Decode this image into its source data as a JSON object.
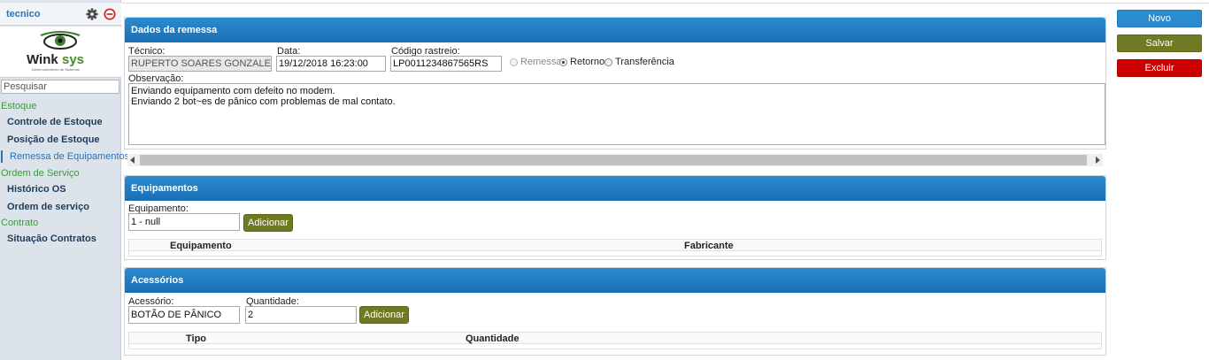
{
  "sidebar": {
    "user": "tecnico",
    "logo_text": "Winksys",
    "logo_tagline": "Desenvolvimento de Sistemas",
    "search_placeholder": "Pesquisar",
    "categories": [
      {
        "label": "Estoque"
      },
      {
        "label": "Ordem de Serviço"
      },
      {
        "label": "Contrato"
      }
    ],
    "items": [
      {
        "label": "Controle de Estoque"
      },
      {
        "label": "Posição de Estoque"
      },
      {
        "label": "Remessa de Equipamentos",
        "active": true
      },
      {
        "label": "Histórico OS"
      },
      {
        "label": "Ordem de serviço"
      },
      {
        "label": "Situação Contratos"
      }
    ],
    "icons": {
      "settings": "gear-icon",
      "logout": "minus-circle-icon"
    }
  },
  "remessa": {
    "title": "Dados da remessa",
    "tecnico_label": "Técnico:",
    "tecnico_value": "RUPERTO SOARES GONZALES",
    "data_label": "Data:",
    "data_value": "19/12/2018 16:23:00",
    "codigo_label": "Código rastreio:",
    "codigo_value": "LP0011234867565RS",
    "radio_remessa": "Remessa",
    "radio_retorno": "Retorno",
    "radio_transferencia": "Transferência",
    "selected_radio": "Retorno",
    "obs_label": "Observação:",
    "obs_line1": "Enviando equipamento com defeito no modem.",
    "obs_line2": "Enviando 2 bot~es de pânico com problemas de mal contato."
  },
  "equipamentos": {
    "title": "Equipamentos",
    "field_label": "Equipamento:",
    "field_value": "1 - null",
    "add_label": "Adicionar",
    "col_equipamento": "Equipamento",
    "col_fabricante": "Fabricante"
  },
  "acessorios": {
    "title": "Acessórios",
    "acessorio_label": "Acessório:",
    "acessorio_value": "BOTÃO DE PÂNICO",
    "quantidade_label": "Quantidade:",
    "quantidade_value": "2",
    "add_label": "Adicionar",
    "col_tipo": "Tipo",
    "col_quantidade": "Quantidade"
  },
  "actions": {
    "novo": "Novo",
    "salvar": "Salvar",
    "excluir": "Excluir"
  },
  "colors": {
    "primary": "#2a8bd0",
    "olive": "#6f7a23",
    "danger": "#cc0000",
    "sidebar_link": "#1d3b5c",
    "category": "#3a9a3a"
  }
}
